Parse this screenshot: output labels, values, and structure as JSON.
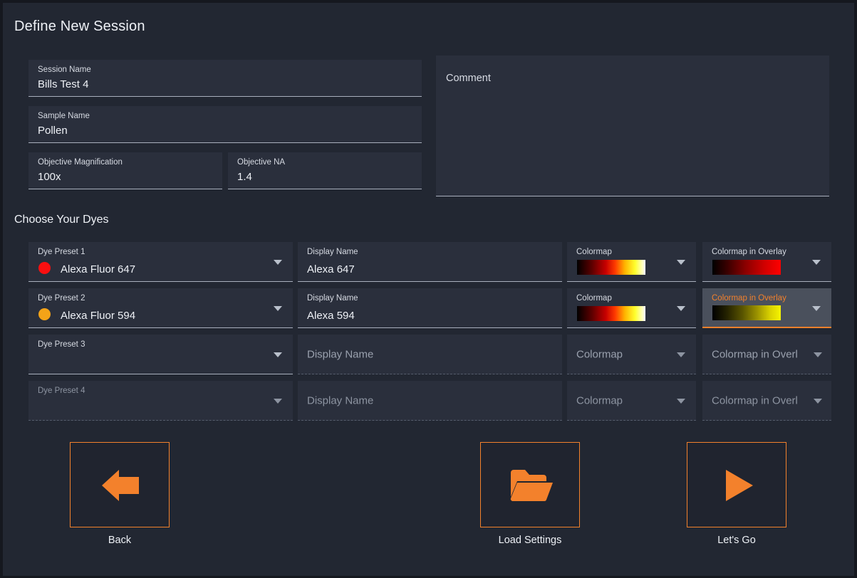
{
  "page": {
    "title": "Define New Session",
    "section_title": "Choose Your Dyes",
    "accent_color": "#f3812c",
    "background_color": "#222732",
    "field_background": "#2a2f3c"
  },
  "session": {
    "session_name": {
      "label": "Session Name",
      "value": "Bills Test 4"
    },
    "sample_name": {
      "label": "Sample Name",
      "value": "Pollen"
    },
    "objective_magnification": {
      "label": "Objective Magnification",
      "value": "100x"
    },
    "objective_na": {
      "label": "Objective NA",
      "value": "1.4"
    },
    "comment": {
      "label": "Comment",
      "value": ""
    }
  },
  "dye_table": {
    "columns": [
      "Dye Preset",
      "Display Name",
      "Colormap",
      "Colormap in Overlay"
    ],
    "rows": [
      {
        "preset_label": "Dye Preset 1",
        "preset_value": "Alexa Fluor 647",
        "preset_dot_color": "#fa0f10",
        "display_label": "Display Name",
        "display_value": "Alexa 647",
        "colormap_label": "Colormap",
        "colormap_name": "hot",
        "overlay_label": "Colormap in Overlay",
        "overlay_name": "red",
        "enabled": true,
        "focused": false
      },
      {
        "preset_label": "Dye Preset 2",
        "preset_value": "Alexa Fluor 594",
        "preset_dot_color": "#f4a318",
        "display_label": "Display Name",
        "display_value": "Alexa 594",
        "colormap_label": "Colormap",
        "colormap_name": "hot",
        "overlay_label": "Colormap in Overlay",
        "overlay_name": "yellow",
        "enabled": true,
        "focused": true
      },
      {
        "preset_label": "Dye Preset 3",
        "preset_value": "",
        "preset_dot_color": "",
        "display_label": "",
        "display_placeholder": "Display Name",
        "colormap_placeholder": "Colormap",
        "overlay_placeholder": "Colormap in Overl",
        "enabled": true,
        "focused": false
      },
      {
        "preset_label": "Dye Preset 4",
        "preset_value": "",
        "preset_dot_color": "",
        "display_label": "",
        "display_placeholder": "Display Name",
        "colormap_placeholder": "Colormap",
        "overlay_placeholder": "Colormap in Overl",
        "enabled": false,
        "focused": false
      }
    ]
  },
  "actions": {
    "back": {
      "label": "Back",
      "icon": "arrow-left-icon"
    },
    "load_settings": {
      "label": "Load Settings",
      "icon": "folder-open-icon"
    },
    "lets_go": {
      "label": "Let's Go",
      "icon": "play-icon"
    }
  }
}
